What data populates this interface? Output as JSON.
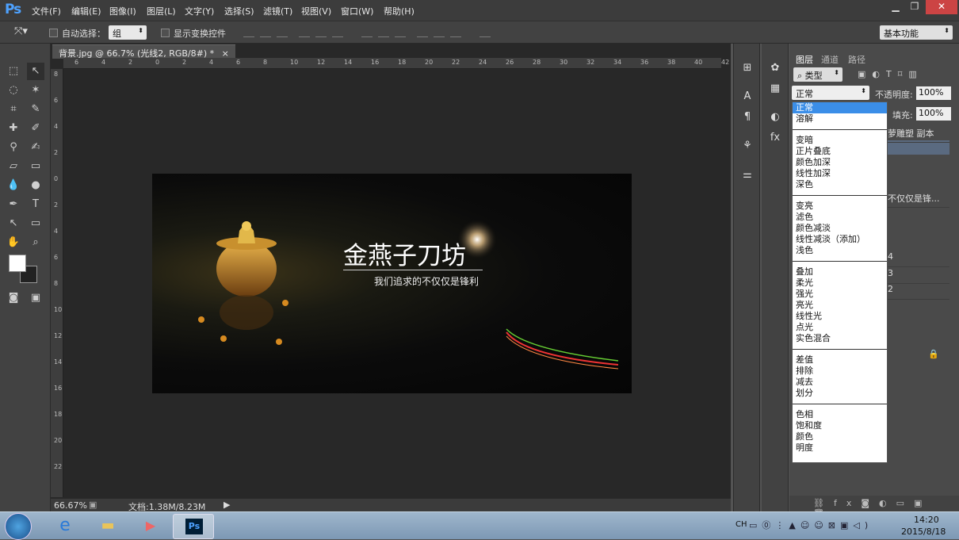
{
  "app": {
    "logo": "Ps"
  },
  "menubar": {
    "items": [
      "文件(F)",
      "编辑(E)",
      "图像(I)",
      "图层(L)",
      "文字(Y)",
      "选择(S)",
      "滤镜(T)",
      "视图(V)",
      "窗口(W)",
      "帮助(H)"
    ]
  },
  "window_controls": {
    "minimize": "▁",
    "restore": "❐",
    "close": "✕"
  },
  "options_bar": {
    "auto_select_label": "自动选择：",
    "auto_select_value": "组",
    "show_transform_label": "显示变换控件",
    "workspace_value": "基本功能"
  },
  "document": {
    "tab_title": "背景.jpg @ 66.7% (光线2, RGB/8#) *",
    "tab_close": "×",
    "zoom": "66.67%",
    "doc_size": "文档:1.38M/8.23M",
    "ruler_h": [
      "6",
      "4",
      "2",
      "0",
      "2",
      "4",
      "6",
      "8",
      "10",
      "12",
      "14",
      "16",
      "18",
      "20",
      "22",
      "24",
      "26",
      "28",
      "30",
      "32",
      "34",
      "36",
      "38",
      "40",
      "42"
    ],
    "ruler_v": [
      "8",
      "6",
      "4",
      "2",
      "0",
      "2",
      "4",
      "6",
      "8",
      "10",
      "12",
      "14",
      "16",
      "18",
      "20",
      "22"
    ]
  },
  "canvas": {
    "title": "金燕子刀坊",
    "subtitle": "我们追求的不仅仅是锋利"
  },
  "layers_panel": {
    "tabs": [
      "图层",
      "通道",
      "路径"
    ],
    "filter_value": "类型",
    "blend_mode": "正常",
    "opacity_label": "不透明度:",
    "opacity_value": "100%",
    "fill_label": "填充:",
    "fill_value": "100%",
    "visible_rows": [
      "萝雕塑 副本",
      "",
      "",
      "不仅仅是锋...",
      "",
      "4",
      "3",
      "2",
      "",
      ""
    ]
  },
  "blend_dropdown": {
    "groups": [
      [
        "正常",
        "溶解"
      ],
      [
        "变暗",
        "正片叠底",
        "颜色加深",
        "线性加深",
        "深色"
      ],
      [
        "变亮",
        "滤色",
        "颜色减淡",
        "线性减淡（添加）",
        "浅色"
      ],
      [
        "叠加",
        "柔光",
        "强光",
        "亮光",
        "线性光",
        "点光",
        "实色混合"
      ],
      [
        "差值",
        "排除",
        "减去",
        "划分"
      ],
      [
        "色相",
        "饱和度",
        "颜色",
        "明度"
      ]
    ],
    "selected": "正常"
  },
  "taskbar": {
    "lang": "CH",
    "time": "14:20",
    "date": "2015/8/18",
    "ps_label": "Ps"
  },
  "colors": {
    "accent_blue": "#3b8ee8",
    "ps_blue": "#4ea2ff",
    "panel_bg": "#4a4a4a"
  }
}
